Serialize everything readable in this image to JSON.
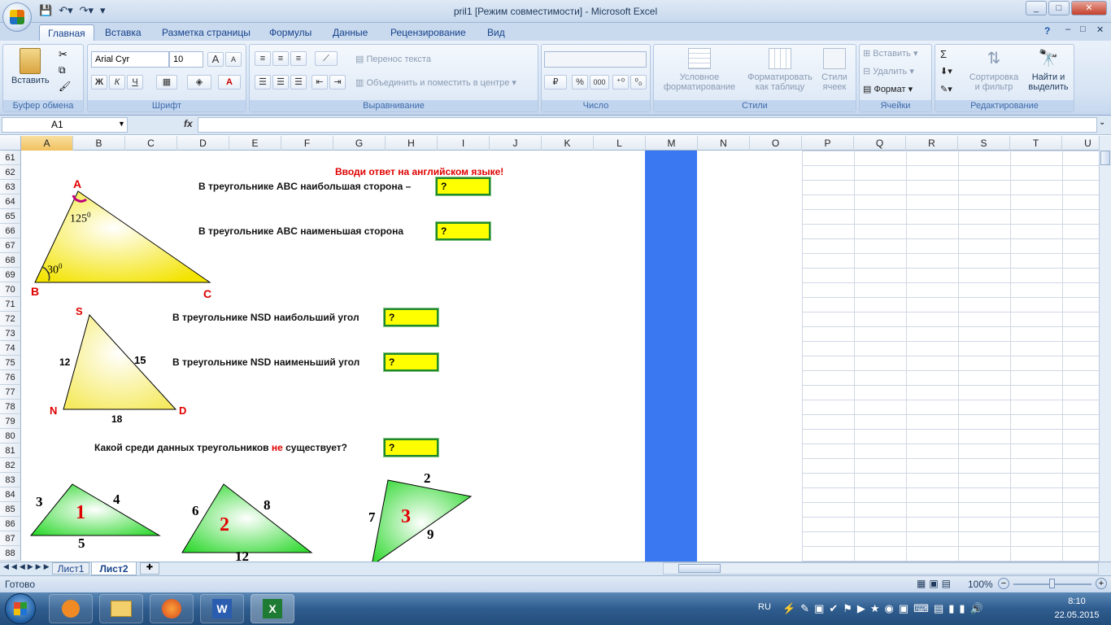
{
  "window": {
    "title": "pril1  [Режим совместимости] - Microsoft Excel",
    "min": "_",
    "max": "□",
    "close": "✕",
    "doc_min": "–",
    "doc_max": "□",
    "doc_close": "✕",
    "help": "?"
  },
  "tabs": [
    "Главная",
    "Вставка",
    "Разметка страницы",
    "Формулы",
    "Данные",
    "Рецензирование",
    "Вид"
  ],
  "ribbon": {
    "clipboard": {
      "label": "Буфер обмена",
      "paste": "Вставить"
    },
    "font": {
      "label": "Шрифт",
      "name": "Arial Cyr",
      "size": "10",
      "bold": "Ж",
      "italic": "К",
      "underline": "Ч",
      "grow": "A",
      "shrink": "A"
    },
    "align": {
      "label": "Выравнивание",
      "wrap": "Перенос текста",
      "merge": "Объединить и поместить в центре"
    },
    "number": {
      "label": "Число",
      "format": "",
      "percent": "%",
      "thousands": "000"
    },
    "styles": {
      "label": "Стили",
      "cond1": "Условное",
      "cond2": "форматирование",
      "tbl1": "Форматировать",
      "tbl2": "как таблицу",
      "cell1": "Стили",
      "cell2": "ячеек"
    },
    "cells": {
      "label": "Ячейки",
      "insert": "Вставить",
      "delete": "Удалить",
      "format": "Формат"
    },
    "editing": {
      "label": "Редактирование",
      "sum": "Σ",
      "sort1": "Сортировка",
      "sort2": "и фильтр",
      "find1": "Найти и",
      "find2": "выделить"
    }
  },
  "formula": {
    "namebox": "A1",
    "fx": "fx",
    "value": ""
  },
  "columns": [
    "A",
    "B",
    "C",
    "D",
    "E",
    "F",
    "G",
    "H",
    "I",
    "J",
    "K",
    "L",
    "M",
    "N",
    "O",
    "P",
    "Q",
    "R",
    "S",
    "T",
    "U"
  ],
  "rows": [
    "61",
    "62",
    "63",
    "64",
    "65",
    "66",
    "67",
    "68",
    "69",
    "70",
    "71",
    "72",
    "73",
    "74",
    "75",
    "76",
    "77",
    "78",
    "79",
    "80",
    "81",
    "82",
    "83",
    "84",
    "85",
    "86",
    "87",
    "88"
  ],
  "sheet": {
    "hint": "Вводи ответ на английском языке!",
    "q1": "В треугольнике ABC наибольшая сторона –",
    "q2": "В треугольнике ABC наименьшая сторона",
    "q3": "В треугольнике NSD наибольший угол",
    "q4": "В треугольнике NSD наименьший угол",
    "q5a": "Какой среди данных треугольников ",
    "q5b": "не",
    "q5c": " существует?",
    "answer": "?",
    "tri_abc": {
      "A": "A",
      "B": "B",
      "C": "C",
      "angA": "125",
      "angB": "30",
      "deg": "0"
    },
    "tri_nsd": {
      "N": "N",
      "S": "S",
      "D": "D",
      "ns": "12",
      "sd": "15",
      "nd": "18"
    },
    "t1": {
      "num": "1",
      "a": "3",
      "b": "4",
      "c": "5"
    },
    "t2": {
      "num": "2",
      "a": "6",
      "b": "8",
      "c": "12"
    },
    "t3": {
      "num": "3",
      "a": "7",
      "b": "2",
      "c": "9"
    }
  },
  "sheets": [
    "Лист1",
    "Лист2"
  ],
  "status": {
    "ready": "Готово",
    "zoom": "100%"
  },
  "tray": {
    "lang": "RU",
    "time": "8:10",
    "date": "22.05.2015"
  }
}
